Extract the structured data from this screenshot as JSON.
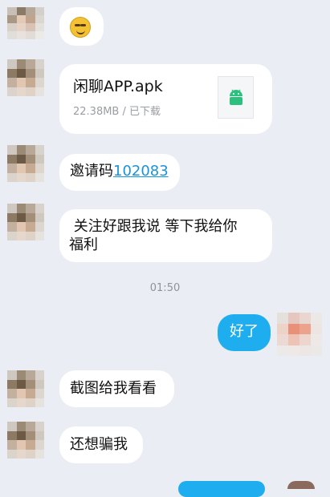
{
  "messages": {
    "file": {
      "name": "闲聊APP.apk",
      "meta": "22.38MB / 已下载"
    },
    "invite": {
      "prefix": "邀请码",
      "code": "102083"
    },
    "follow": {
      "line1": " 关注好跟我说 等下我给你",
      "line2": "福利"
    },
    "time": "01:50",
    "out_reply": "好了",
    "screenshot": "截图给我看看",
    "scam": "还想骗我"
  },
  "colors": {
    "outgoing": "#1eaef0",
    "link": "#1a93d8",
    "background": "#eaedf4"
  },
  "icons": {
    "emoji": "grinning-face-icon",
    "apk": "android-icon"
  }
}
